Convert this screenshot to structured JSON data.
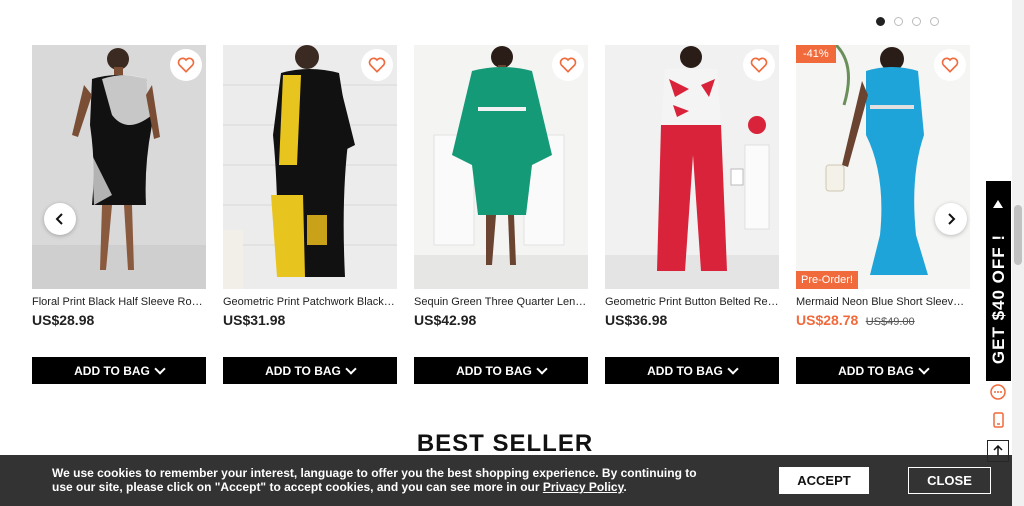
{
  "carousel": {
    "dots": 4,
    "active_dot": 0
  },
  "products": [
    {
      "name": "Floral Print Black Half Sleeve Round ...",
      "price": "US$28.98",
      "old_price": "",
      "discount_badge": "",
      "pre_order": "",
      "add_label": "ADD TO BAG"
    },
    {
      "name": "Geometric Print Patchwork Black L...",
      "price": "US$31.98",
      "old_price": "",
      "discount_badge": "",
      "pre_order": "",
      "add_label": "ADD TO BAG"
    },
    {
      "name": "Sequin Green Three Quarter Length...",
      "price": "US$42.98",
      "old_price": "",
      "discount_badge": "",
      "pre_order": "",
      "add_label": "ADD TO BAG"
    },
    {
      "name": "Geometric Print Button Belted Red ...",
      "price": "US$36.98",
      "old_price": "",
      "discount_badge": "",
      "pre_order": "",
      "add_label": "ADD TO BAG"
    },
    {
      "name": "Mermaid Neon Blue Short Sleeve V ...",
      "price": "US$28.78",
      "old_price": "US$49.00",
      "discount_badge": "-41%",
      "pre_order": "Pre-Order!",
      "add_label": "ADD TO BAG"
    }
  ],
  "section_title": "BEST SELLER",
  "promo": {
    "label": "GET $40 OFF !"
  },
  "cookie": {
    "message": "We use cookies to remember your interest, language to offer you the best shopping experience. By continuing to use our site, please click on \"Accept\" to accept cookies, and you can see more in our",
    "link": "Privacy Policy",
    "link_suffix": ".",
    "accept_label": "ACCEPT",
    "close_label": "CLOSE"
  },
  "colors": {
    "accent": "#f06a3c",
    "dark": "#000000"
  },
  "icons": [
    "heart-icon",
    "chevron-left-icon",
    "chevron-right-icon",
    "chat-icon",
    "phone-icon",
    "arrow-up-icon"
  ]
}
